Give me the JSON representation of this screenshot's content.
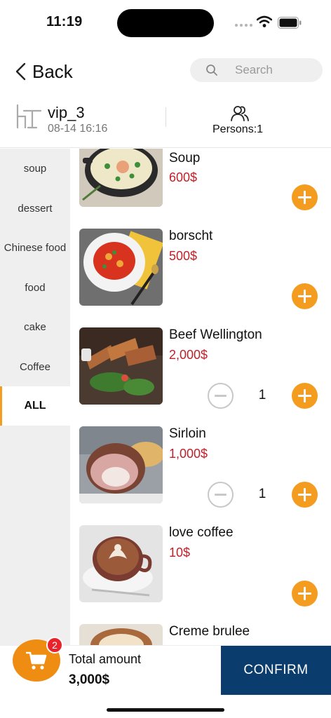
{
  "status_bar": {
    "time": "11:19"
  },
  "nav": {
    "back_label": "Back",
    "search_placeholder": "Search"
  },
  "table_info": {
    "name": "vip_3",
    "time": "08-14 16:16",
    "persons": "Persons:1"
  },
  "categories": [
    {
      "label": "soup"
    },
    {
      "label": "dessert"
    },
    {
      "label": "Chinese food"
    },
    {
      "label": "food"
    },
    {
      "label": "cake"
    },
    {
      "label": "Coffee"
    },
    {
      "label": "ALL",
      "active": true
    }
  ],
  "dishes": [
    {
      "name": "Soup",
      "price": "600$",
      "quantity": null
    },
    {
      "name": "borscht",
      "price": "500$",
      "quantity": null
    },
    {
      "name": "Beef Wellington",
      "price": "2,000$",
      "quantity": "1"
    },
    {
      "name": "Sirloin",
      "price": "1,000$",
      "quantity": "1"
    },
    {
      "name": "love coffee",
      "price": "10$",
      "quantity": null
    },
    {
      "name": "Creme brulee",
      "price": "",
      "quantity": null
    }
  ],
  "cart": {
    "badge_count": "2",
    "total_label": "Total amount",
    "total_value": "3,000$"
  },
  "actions": {
    "confirm_label": "CONFIRM"
  },
  "colors": {
    "accent": "#f39c1f",
    "price": "#c0202a",
    "confirm_bg": "#0a3d6e",
    "badge": "#e8232b"
  }
}
